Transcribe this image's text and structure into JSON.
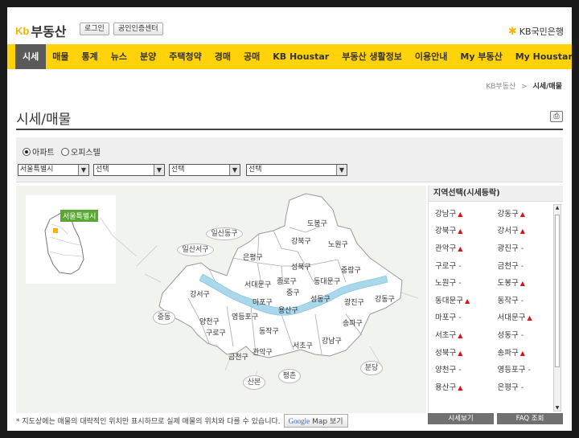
{
  "header": {
    "logo_mark": "Kb",
    "logo_text": "부동산",
    "login_label": "로그인",
    "cert_label": "공인인증센터",
    "bank_name": "KB국민은행",
    "brand_color": "#ffd20a"
  },
  "nav": {
    "items": [
      "시세",
      "매물",
      "통계",
      "뉴스",
      "분양",
      "주택청약",
      "경매",
      "공매",
      "KB Houstar",
      "부동산 생활정보",
      "이용안내"
    ],
    "right_items": [
      "My 부동산",
      "My Houstar"
    ]
  },
  "breadcrumb": {
    "home": "KB부동산",
    "separator": ">",
    "current": "시세/매물"
  },
  "page": {
    "title": "시세/매물"
  },
  "filter": {
    "radio_apartment": "아파트",
    "radio_officetel": "오피스텔",
    "select_city": "서울특별시",
    "select_2": "선택",
    "select_3": "선택",
    "select_4": "선택"
  },
  "map": {
    "inset_label": "서울특별시",
    "districts": [
      "도봉구",
      "강북구",
      "노원구",
      "은평구",
      "성북구",
      "중랑구",
      "종로구",
      "동대문구",
      "서대문구",
      "중구",
      "마포구",
      "성동구",
      "광진구",
      "강동구",
      "용산구",
      "강서구",
      "양천구",
      "영등포구",
      "동작구",
      "구로구",
      "송파구",
      "강남구",
      "서초구",
      "관악구",
      "금천구"
    ],
    "outside": [
      "일산동구",
      "일산서구",
      "김포",
      "중동",
      "평촌",
      "분당",
      "산본"
    ]
  },
  "side": {
    "title": "지역선택(시세등락)",
    "rows": [
      [
        {
          "name": "강남구",
          "trend": "▲"
        },
        {
          "name": "강동구",
          "trend": "▲"
        }
      ],
      [
        {
          "name": "강북구",
          "trend": "▲"
        },
        {
          "name": "강서구",
          "trend": "▲"
        }
      ],
      [
        {
          "name": "관악구",
          "trend": "▲"
        },
        {
          "name": "광진구",
          "trend": "-"
        }
      ],
      [
        {
          "name": "구로구",
          "trend": "-"
        },
        {
          "name": "금천구",
          "trend": "-"
        }
      ],
      [
        {
          "name": "노원구",
          "trend": "-"
        },
        {
          "name": "도봉구",
          "trend": "▲"
        }
      ],
      [
        {
          "name": "동대문구",
          "trend": "▲"
        },
        {
          "name": "동작구",
          "trend": "-"
        }
      ],
      [
        {
          "name": "마포구",
          "trend": "-"
        },
        {
          "name": "서대문구",
          "trend": "▲"
        }
      ],
      [
        {
          "name": "서초구",
          "trend": "▲"
        },
        {
          "name": "성동구",
          "trend": "-"
        }
      ],
      [
        {
          "name": "성북구",
          "trend": "▲"
        },
        {
          "name": "송파구",
          "trend": "▲"
        }
      ],
      [
        {
          "name": "양천구",
          "trend": "-"
        },
        {
          "name": "영등포구",
          "trend": "-"
        }
      ],
      [
        {
          "name": "용산구",
          "trend": "▲"
        },
        {
          "name": "은평구",
          "trend": "-"
        }
      ]
    ]
  },
  "footer": {
    "note": "* 지도상에는 매물의 대략적인 위치만 표시하므로 실제 매물의 위치와 다를 수 있습니다.",
    "google_logo": "Google",
    "google_btn": "Map 보기",
    "btn_price": "시세보기",
    "btn_faq": "FAQ 조회"
  }
}
